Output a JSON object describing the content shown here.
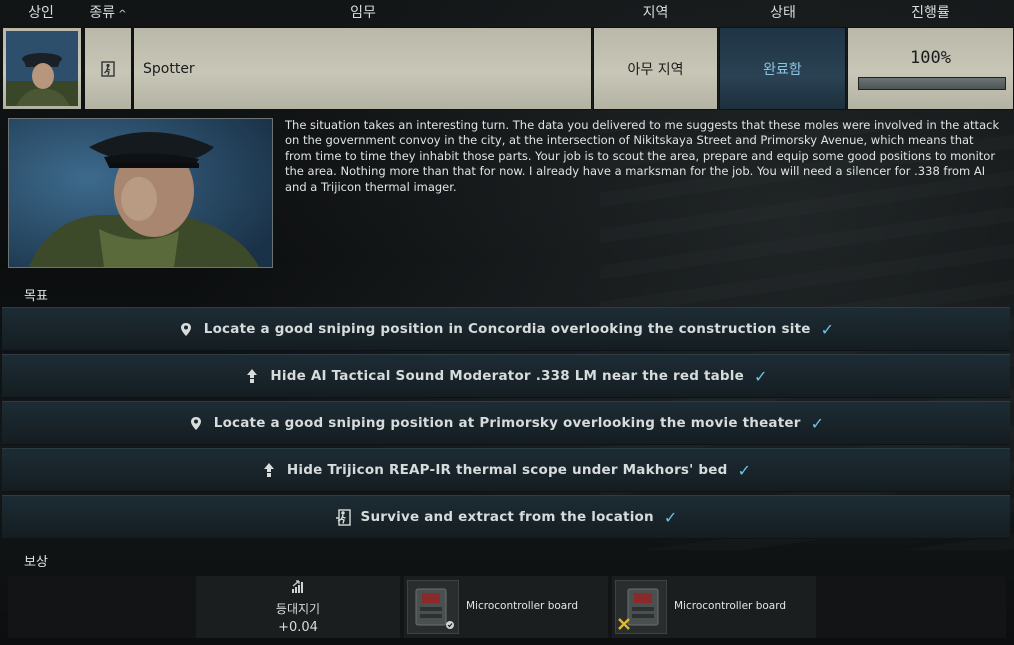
{
  "header": {
    "trader": "상인",
    "type": "종류",
    "quest": "임무",
    "location": "지역",
    "status": "상태",
    "progress": "진행률"
  },
  "quest_row": {
    "name": "Spotter",
    "location": "아무 지역",
    "status": "완료함",
    "progress_text": "100%",
    "progress_fraction": 1.0
  },
  "description": "The situation takes an interesting turn. The data you delivered to me suggests that these moles were involved in the attack on the government convoy in the city, at the intersection of Nikitskaya Street and Primorsky Avenue, which means that from time to time they inhabit those parts. Your job is to scout the area, prepare and equip some good positions to monitor the area. Nothing more than that for now. I already have a marksman for the job. You will need a silencer for .338 from AI and a Trijicon thermal imager.",
  "objectives_label": "목표",
  "objectives": [
    {
      "icon": "location-pin-icon",
      "text": "Locate a good sniping position in Concordia overlooking the construction site"
    },
    {
      "icon": "place-arrow-icon",
      "text": "Hide AI Tactical Sound Moderator .338 LM near the red table"
    },
    {
      "icon": "location-pin-icon",
      "text": "Locate a good sniping position at Primorsky overlooking the movie theater"
    },
    {
      "icon": "place-arrow-icon",
      "text": "Hide Trijicon REAP-IR thermal scope under Makhors' bed"
    },
    {
      "icon": "exit-icon",
      "text": "Survive and extract from the location"
    }
  ],
  "rewards_label": "보상",
  "rewards": {
    "reputation": {
      "label": "등대지기",
      "value": "+0.04",
      "icon": "reputation-bars-icon"
    },
    "items": [
      {
        "name": "Microcontroller board",
        "icon": "circuit-board-icon"
      },
      {
        "name": "Microcontroller board",
        "icon": "circuit-board-icon"
      }
    ]
  },
  "colors": {
    "status_blue": "#8cc4e4",
    "check_blue": "#6cc2e8",
    "objective_bg": "#1a262d"
  }
}
